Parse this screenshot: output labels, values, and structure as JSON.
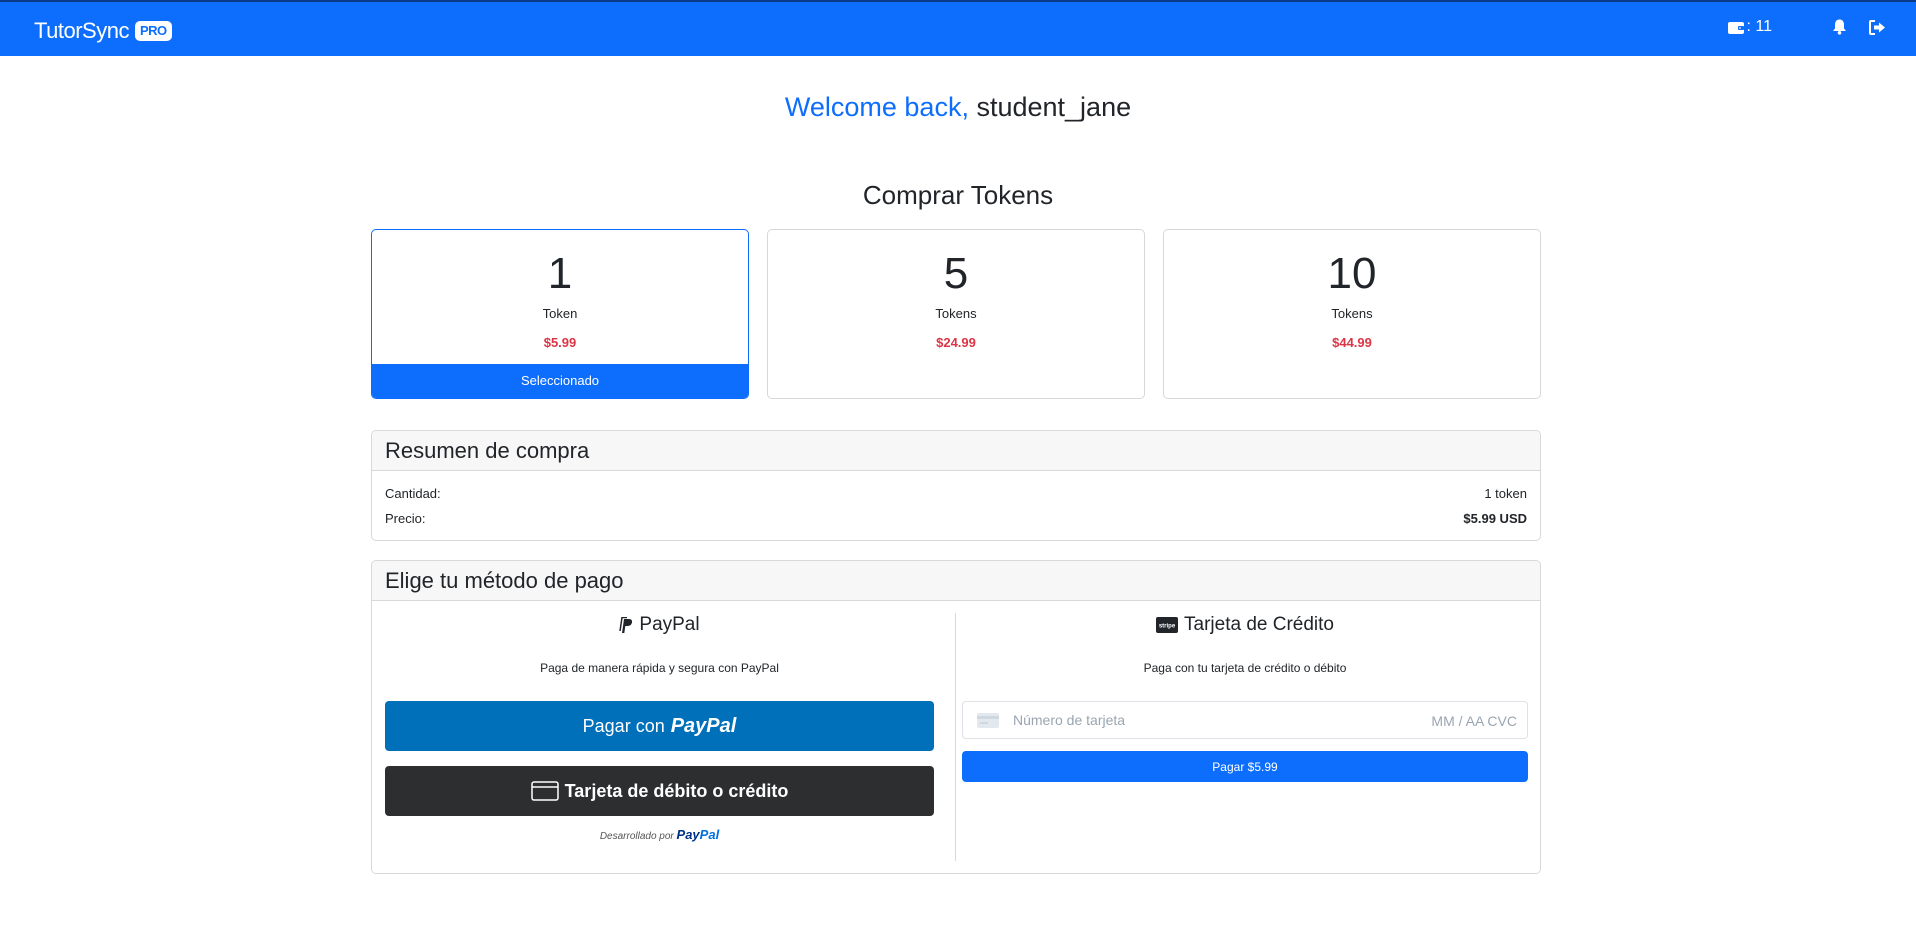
{
  "navbar": {
    "brand": "TutorSync",
    "brand_badge": "PRO",
    "wallet_icon": "wallet-icon",
    "token_balance": ": 11",
    "bell_icon": "bell-icon",
    "logout_icon": "sign-out-icon",
    "bg_color": "#0d6efd"
  },
  "welcome": {
    "greeting": "Welcome back,",
    "username": "student_jane"
  },
  "purchase": {
    "title": "Comprar Tokens",
    "packages": [
      {
        "amount": "1",
        "unit": "Token",
        "price": "$5.99",
        "selected": true
      },
      {
        "amount": "5",
        "unit": "Tokens",
        "price": "$24.99",
        "selected": false
      },
      {
        "amount": "10",
        "unit": "Tokens",
        "price": "$44.99",
        "selected": false
      }
    ],
    "selected_label": "Seleccionado",
    "price_color": "#dc3545"
  },
  "summary": {
    "title": "Resumen de compra",
    "quantity_label": "Cantidad:",
    "quantity_value": "1 token",
    "price_label": "Precio:",
    "price_value": "$5.99 USD"
  },
  "payment": {
    "title": "Elige tu método de pago",
    "paypal": {
      "icon": "paypal-icon",
      "title": "PayPal",
      "description": "Paga de manera rápida y segura con PayPal",
      "button_prefix": "Pagar con",
      "button_logo": "PayPal",
      "card_button": "Tarjeta de débito o crédito",
      "powered_by": "Desarrollado por",
      "powered_logo_a": "Pay",
      "powered_logo_b": "Pal"
    },
    "stripe": {
      "icon": "stripe-icon",
      "title": "Tarjeta de Crédito",
      "description": "Paga con tu tarjeta de crédito o débito",
      "card_placeholder": "Número de tarjeta",
      "expiry_cvc_placeholder": "MM / AA  CVC",
      "pay_button": "Pagar $5.99"
    }
  }
}
